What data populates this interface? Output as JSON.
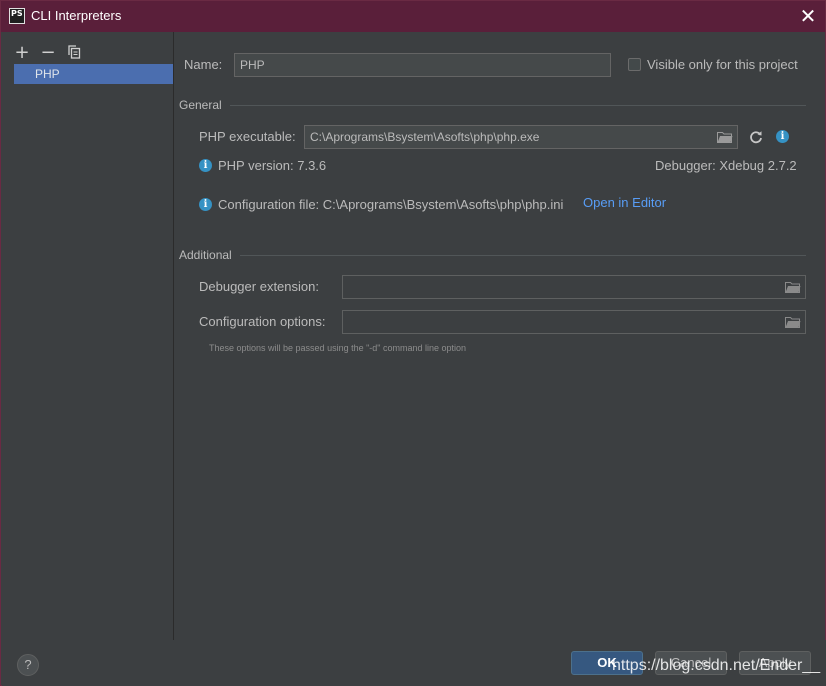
{
  "window": {
    "app_icon_text": "PS",
    "title": "CLI Interpreters",
    "close_glyph": "✕"
  },
  "toolbar": {
    "add_glyph": "+",
    "remove_glyph": "−",
    "copy_icon": "copy-icon"
  },
  "interpreters": [
    {
      "label": "PHP"
    }
  ],
  "form": {
    "name_label": "Name:",
    "name_value": "PHP",
    "visible_only_label": "Visible only for this project",
    "visible_only_checked": false,
    "general_section": "General",
    "php_executable_label": "PHP executable:",
    "php_executable_value": "C:\\Aprograms\\Bsystem\\Asofts\\php\\php.exe",
    "php_version": "PHP version: 7.3.6",
    "debugger": "Debugger: Xdebug 2.7.2",
    "config_file": "Configuration file: C:\\Aprograms\\Bsystem\\Asofts\\php\\php.ini",
    "open_in_editor": "Open in Editor",
    "additional_section": "Additional",
    "debugger_extension_label": "Debugger extension:",
    "debugger_extension_value": "",
    "config_options_label": "Configuration options:",
    "config_options_value": "",
    "hint": "These options will be passed using the \"-d\" command line option"
  },
  "footer": {
    "help_glyph": "?",
    "ok_label": "OK",
    "cancel_label": "Cancel",
    "apply_label": "Apply",
    "watermark": "https://blog.csdn.net/Ender__"
  },
  "colors": {
    "titlebar": "#5a1f3a",
    "selection": "#4b6eaf",
    "link": "#589df6",
    "info": "#3592c4"
  }
}
